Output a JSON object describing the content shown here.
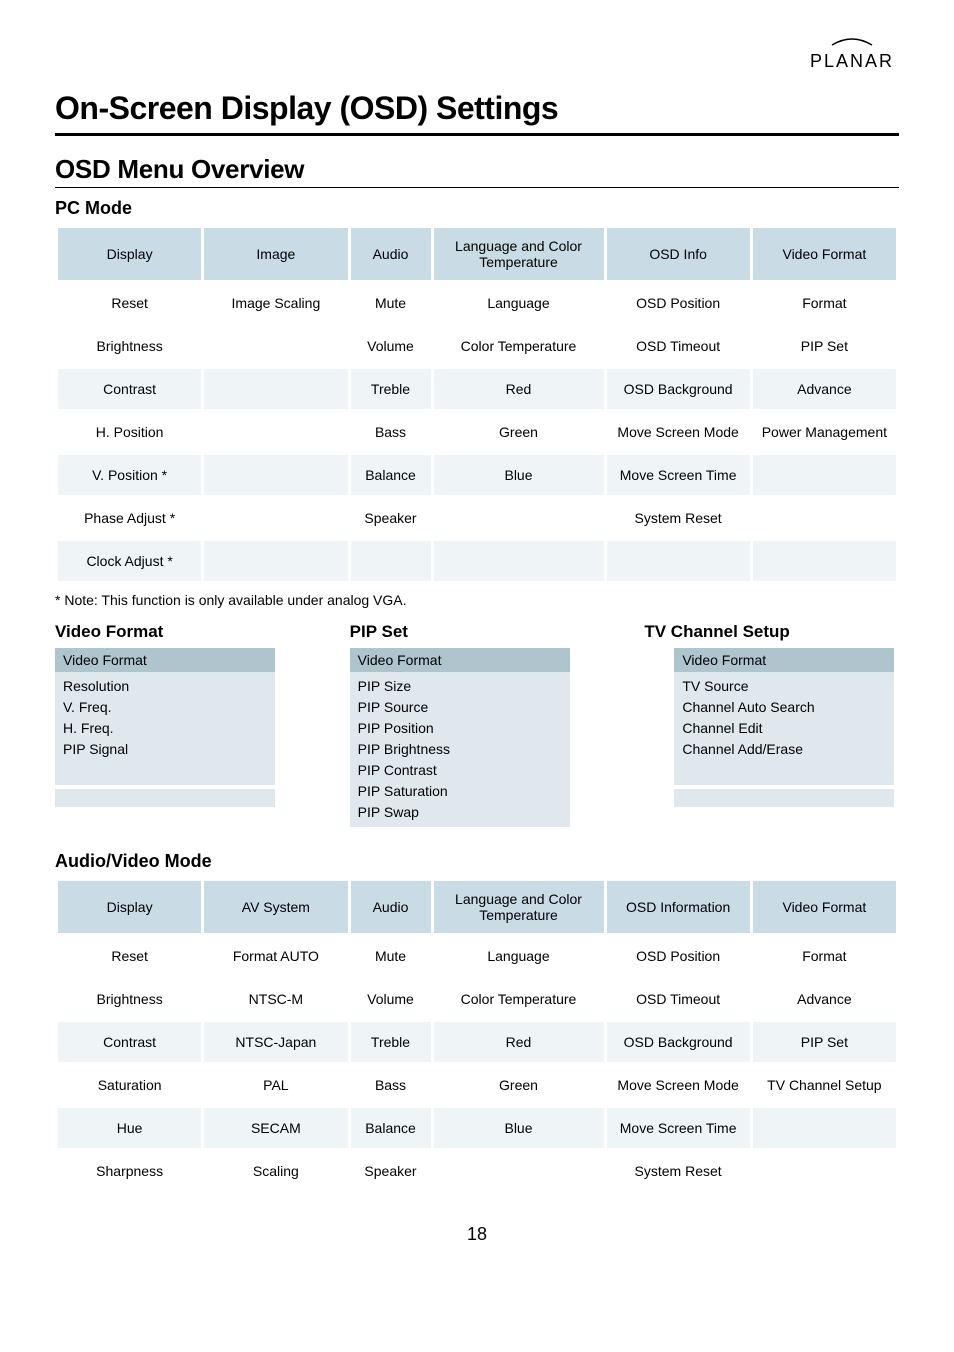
{
  "logo_text": "PLANAR",
  "main_title": "On-Screen Display (OSD) Settings",
  "section_title": "OSD Menu Overview",
  "pc_mode": {
    "title": "PC Mode",
    "headers": [
      "Display",
      "Image",
      "Audio",
      "Language and Color Temperature",
      "OSD Info",
      "Video Format"
    ],
    "rows": [
      [
        "Reset",
        "Image Scaling",
        "Mute",
        "Language",
        "OSD Position",
        "Format"
      ],
      [
        "Brightness",
        "",
        "Volume",
        "Color Temperature",
        "OSD Timeout",
        "PIP Set"
      ],
      [
        "Contrast",
        "",
        "Treble",
        "Red",
        "OSD Background",
        "Advance"
      ],
      [
        "H. Position",
        "",
        "Bass",
        "Green",
        "Move Screen Mode",
        "Power Management"
      ],
      [
        "V. Position *",
        "",
        "Balance",
        "Blue",
        "Move Screen Time",
        ""
      ],
      [
        "Phase Adjust *",
        "",
        "Speaker",
        "",
        "System Reset",
        ""
      ],
      [
        "Clock Adjust *",
        "",
        "",
        "",
        "",
        ""
      ]
    ]
  },
  "note": "* Note: This function is only available under analog VGA.",
  "video_format": {
    "title": "Video Format",
    "header": "Video Format",
    "items": [
      "Resolution",
      "V. Freq.",
      "H. Freq.",
      "PIP Signal"
    ]
  },
  "pip_set": {
    "title": "PIP Set",
    "header": "Video Format",
    "items": [
      "PIP Size",
      "PIP Source",
      "PIP Position",
      "PIP Brightness",
      "PIP Contrast",
      "PIP Saturation",
      "PIP Swap"
    ]
  },
  "tv_channel": {
    "title": "TV Channel Setup",
    "header": "Video Format",
    "items": [
      "TV Source",
      "Channel Auto Search",
      "Channel Edit",
      "Channel Add/Erase"
    ]
  },
  "av_mode": {
    "title": "Audio/Video Mode",
    "headers": [
      "Display",
      "AV System",
      "Audio",
      "Language and Color Temperature",
      "OSD Information",
      "Video Format"
    ],
    "rows": [
      [
        "Reset",
        "Format AUTO",
        "Mute",
        "Language",
        "OSD Position",
        "Format"
      ],
      [
        "Brightness",
        "NTSC-M",
        "Volume",
        "Color Temperature",
        "OSD Timeout",
        "Advance"
      ],
      [
        "Contrast",
        "NTSC-Japan",
        "Treble",
        "Red",
        "OSD Background",
        "PIP Set"
      ],
      [
        "Saturation",
        "PAL",
        "Bass",
        "Green",
        "Move Screen Mode",
        "TV Channel Setup"
      ],
      [
        "Hue",
        "SECAM",
        "Balance",
        "Blue",
        "Move Screen Time",
        ""
      ],
      [
        "Sharpness",
        "Scaling",
        "Speaker",
        "",
        "System Reset",
        ""
      ]
    ]
  },
  "page_number": "18"
}
